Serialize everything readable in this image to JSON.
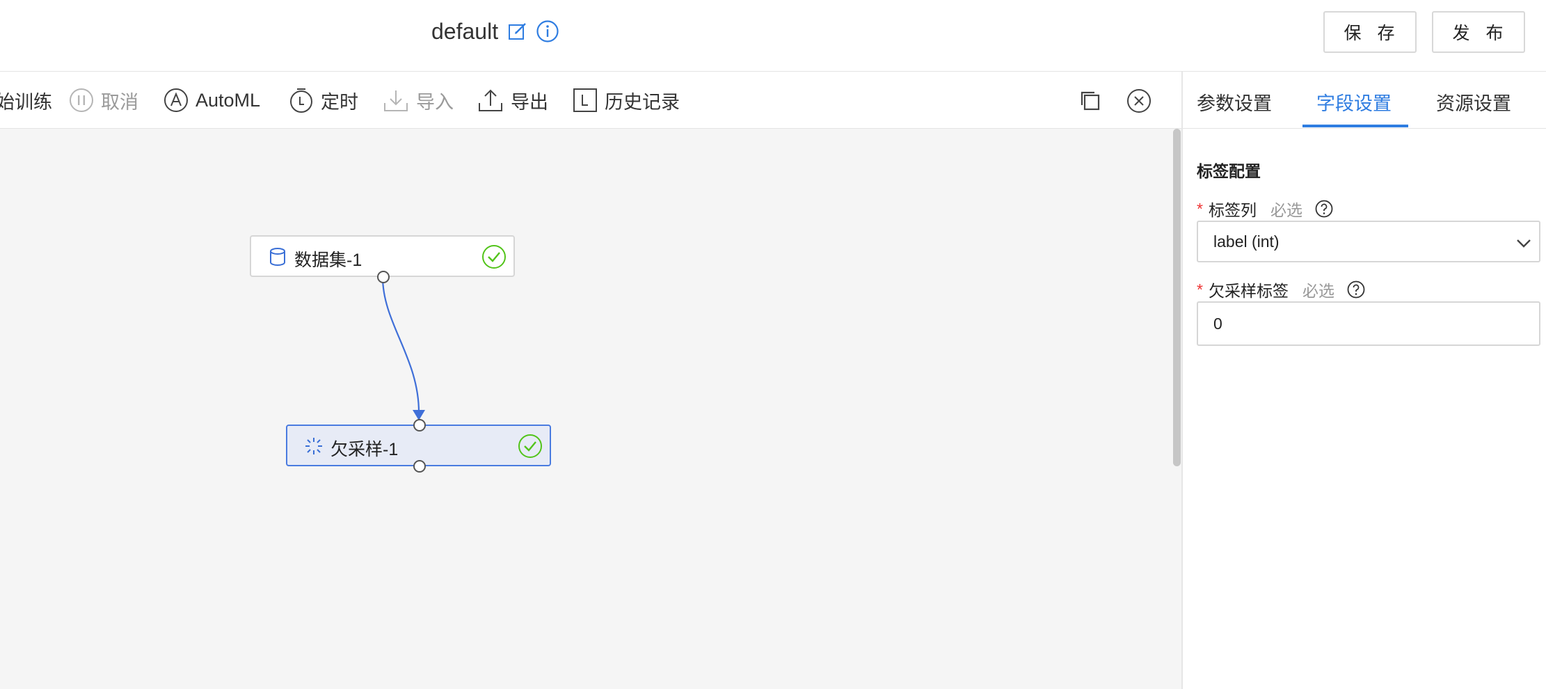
{
  "header": {
    "title": "default",
    "save_label": "保 存",
    "publish_label": "发 布"
  },
  "toolbar": {
    "start_training": "始训练",
    "cancel": "取消",
    "automl": "AutoML",
    "schedule": "定时",
    "import": "导入",
    "export": "导出",
    "history": "历史记录"
  },
  "canvas": {
    "nodes": [
      {
        "label": "数据集-1",
        "icon": "database-icon",
        "status": "success"
      },
      {
        "label": "欠采样-1",
        "icon": "undersample-icon",
        "status": "success",
        "selected": true
      }
    ]
  },
  "panel": {
    "tabs": [
      "参数设置",
      "字段设置",
      "资源设置"
    ],
    "active_tab": "字段设置",
    "section_title": "标签配置",
    "fields": [
      {
        "label": "标签列",
        "hint": "必选",
        "type": "select",
        "value": "label (int)"
      },
      {
        "label": "欠采样标签",
        "hint": "必选",
        "type": "input",
        "value": "0"
      }
    ]
  },
  "colors": {
    "accent": "#2f7de1",
    "success": "#52c41a",
    "required": "#e33333",
    "canvas_bg": "#f5f5f5",
    "selected_node_bg": "#e7ebf6"
  }
}
